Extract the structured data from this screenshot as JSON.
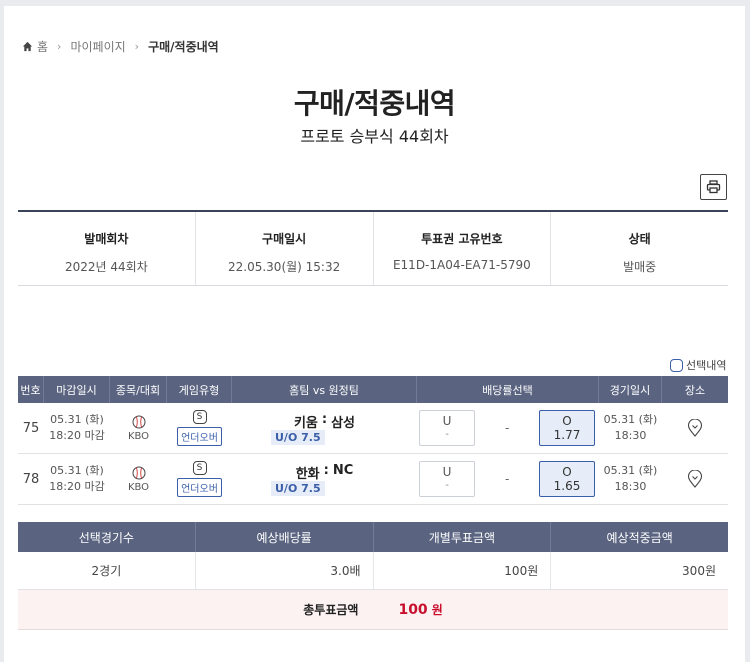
{
  "breadcrumb": {
    "home": "홈",
    "mypage": "마이페이지",
    "current": "구매/적중내역"
  },
  "page": {
    "title": "구매/적중내역",
    "subtitle": "프로토 승부식 44회차"
  },
  "summary": [
    {
      "label": "발매회차",
      "value": "2022년 44회차"
    },
    {
      "label": "구매일시",
      "value": "22.05.30(월) 15:32"
    },
    {
      "label": "투표권 고유번호",
      "value": "E11D-1A04-EA71-5790"
    },
    {
      "label": "상태",
      "value": "발매중"
    }
  ],
  "select_label": "선택내역",
  "games_table": {
    "headers": [
      "번호",
      "마감일시",
      "종목/대회",
      "게임유형",
      "홈팀 vs 원정팀",
      "배당률선택",
      "경기일시",
      "장소"
    ],
    "rows": [
      {
        "no": "75",
        "close_date": "05.31 (화)",
        "close_time": "18:20 마감",
        "league": "KBO",
        "game_badge": "S",
        "game_type": "언더오버",
        "home": "키움",
        "vs": ":",
        "away": "삼성",
        "line": "U/O 7.5",
        "under_label": "U",
        "under_value": "-",
        "draw": "-",
        "over_label": "O",
        "over_value": "1.77",
        "game_date": "05.31 (화)",
        "game_time": "18:30"
      },
      {
        "no": "78",
        "close_date": "05.31 (화)",
        "close_time": "18:20 마감",
        "league": "KBO",
        "game_badge": "S",
        "game_type": "언더오버",
        "home": "한화",
        "vs": ":",
        "away": "NC",
        "line": "U/O 7.5",
        "under_label": "U",
        "under_value": "-",
        "draw": "-",
        "over_label": "O",
        "over_value": "1.65",
        "game_date": "05.31 (화)",
        "game_time": "18:30"
      }
    ]
  },
  "bet_summary": {
    "headers": [
      "선택경기수",
      "예상배당률",
      "개별투표금액",
      "예상적중금액"
    ],
    "values": [
      "2경기",
      "3.0배",
      "100원",
      "300원"
    ],
    "total_label": "총투표금액",
    "total_amount": "100",
    "total_unit": "원"
  },
  "colors": {
    "header_bg": "#5a6380",
    "accent": "#3a5fa8",
    "total_red": "#c8102e"
  },
  "icons": {
    "home": "home-icon",
    "print": "printer-icon",
    "sport": "baseball-icon",
    "place": "location-pin-icon"
  }
}
